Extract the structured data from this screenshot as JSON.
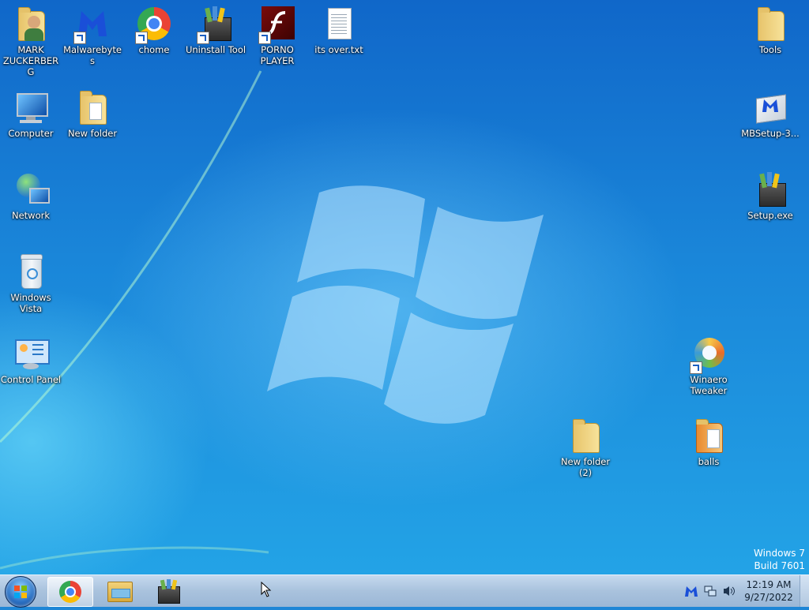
{
  "desktop": {
    "icons": {
      "mark_zuckerberg": "MARK ZUCKERBERG",
      "malwarebytes": "Malwarebytes",
      "chome": "chome",
      "uninstall_tool": "Uninstall Tool",
      "porno_player": "PORNO PLAYER",
      "its_over": "its over.txt",
      "tools": "Tools",
      "computer": "Computer",
      "new_folder": "New folder",
      "mbsetup": "MBSetup-3...",
      "network": "Network",
      "setup_exe": "Setup.exe",
      "windows_vista": "Windows Vista",
      "control_panel": "Control Panel",
      "winaero_tweaker": "Winaero Tweaker",
      "new_folder_2": "New folder (2)",
      "balls": "balls"
    }
  },
  "watermark": {
    "line1": "Windows 7",
    "line2": "Build 7601"
  },
  "taskbar": {
    "clock_time": "12:19 AM",
    "clock_date": "9/27/2022"
  },
  "colors": {
    "wallpaper": "#1a86d9",
    "taskbar": "#a9c2dd",
    "label_text": "#ffffff"
  }
}
